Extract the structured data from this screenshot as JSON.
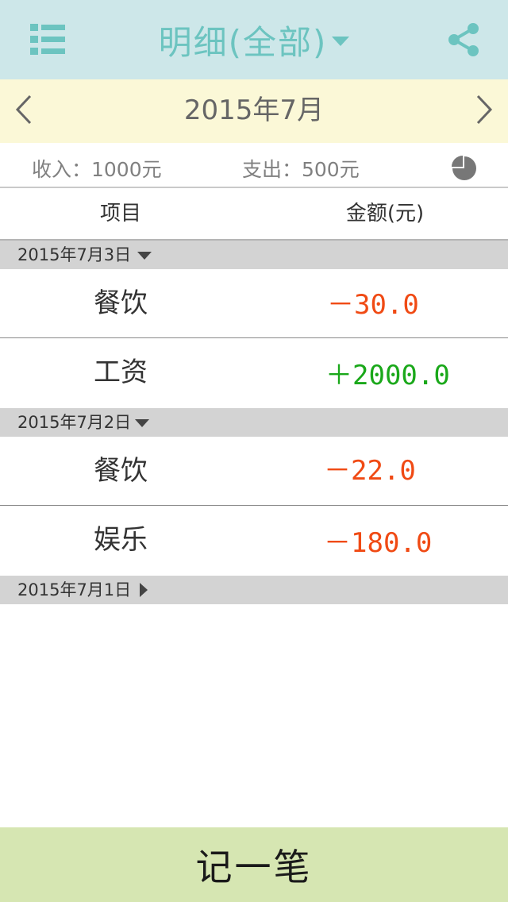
{
  "header": {
    "title": "明细(全部)",
    "menu_icon": "list-menu-icon",
    "share_icon": "share-icon",
    "accent_color": "#6cc4c0"
  },
  "month_nav": {
    "label": "2015年7月",
    "prev_icon": "chevron-left-icon",
    "next_icon": "chevron-right-icon"
  },
  "summary": {
    "income_text": "收入：1000元",
    "expense_text": "支出：500元",
    "chart_icon": "pie-chart-icon"
  },
  "columns": {
    "item": "项目",
    "amount": "金额(元)"
  },
  "groups": [
    {
      "date": "2015年7月3日",
      "expanded": true,
      "entries": [
        {
          "item": "餐饮",
          "amount": "－30.0",
          "type": "expense"
        },
        {
          "item": "工资",
          "amount": "＋2000.0",
          "type": "income"
        }
      ]
    },
    {
      "date": "2015年7月2日",
      "expanded": true,
      "entries": [
        {
          "item": "餐饮",
          "amount": "－22.0",
          "type": "expense"
        },
        {
          "item": "娱乐",
          "amount": "－180.0",
          "type": "expense"
        }
      ]
    },
    {
      "date": "2015年7月1日",
      "expanded": false,
      "entries": []
    }
  ],
  "colors": {
    "expense": "#f04a14",
    "income": "#1aa81a"
  },
  "footer": {
    "record_label": "记一笔"
  }
}
